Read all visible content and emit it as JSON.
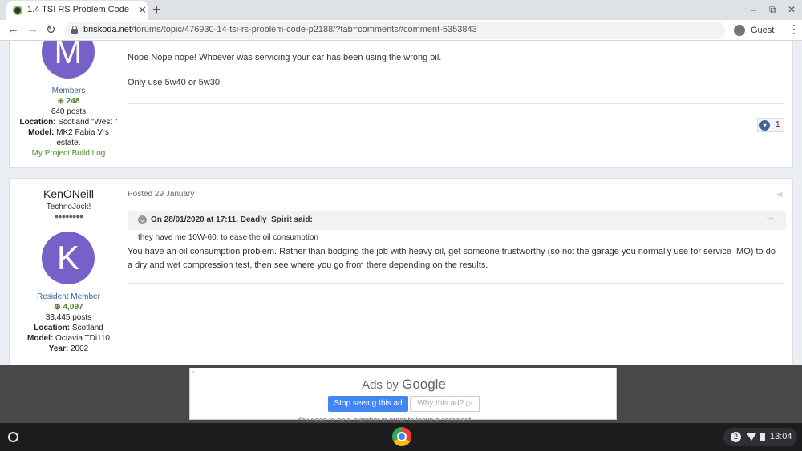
{
  "browser": {
    "tab_title": "1.4 TSI RS Problem Code p2188",
    "tab_close": "✕",
    "new_tab": "+",
    "url_host": "briskoda.net",
    "url_path": "/forums/topic/476930-14-tsi-rs-problem-code-p2188/?tab=comments#comment-5353843",
    "profile_label": "Guest",
    "nav_back": "←",
    "nav_forward": "→",
    "reload": "↻",
    "menu": "⋮",
    "win_min": "–",
    "win_restore": "⧉",
    "win_close": "✕"
  },
  "post1": {
    "avatar_letter": "M",
    "group": "Members",
    "reputation": "248",
    "posts": "640 posts",
    "location_label": "Location:",
    "location": "Scotland \"West \"",
    "model_label": "Model:",
    "model": "MK2 Fabia Vrs estate.",
    "link": "My Project Build Log",
    "body_line1": "Nope Nope nope! Whoever was servicing your car has been using the wrong oil.",
    "body_line2": "Only use 5w40 or 5w30!",
    "reaction_count": "1"
  },
  "post2": {
    "author": "KenONeill",
    "title": "TechnoJock!",
    "avatar_letter": "K",
    "group": "Resident Member",
    "reputation": "4,097",
    "posts": "33,445 posts",
    "location_label": "Location:",
    "location": "Scotland",
    "model_label": "Model:",
    "model": "Octavia TDi110",
    "year_label": "Year:",
    "year": "2002",
    "posted": "Posted 29 January",
    "quote_cite": "On 28/01/2020 at 17:11, Deadly_Spirit said:",
    "quote_body": "they have me 10W-60, to ease the oil consumption",
    "body": "You have an oil consumption problem. Rather than bodging the job with heavy oil, get someone trustworthy (so not the garage you normally use for service IMO) to do a dry and wet compression test, then see where you go from there depending on the results."
  },
  "ad": {
    "title_prefix": "Ads by",
    "title_brand": "Google",
    "stop_button": "Stop seeing this ad",
    "why_button": "Why this ad? ▷",
    "back": "←",
    "underlay_text": "You need to be a member in order to leave a comment"
  },
  "shelf": {
    "notification_count": "2",
    "time": "13:04"
  },
  "colors": {
    "avatar_purple": "#7860c9",
    "link_blue": "#3d6594",
    "rep_green": "#4f7a28",
    "ad_button_blue": "#4285f4"
  }
}
